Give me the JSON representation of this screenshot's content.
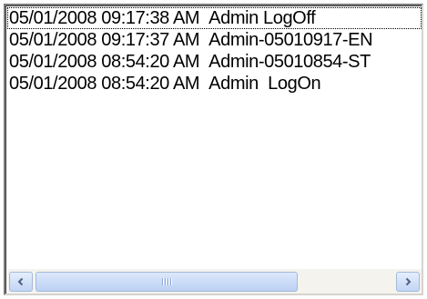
{
  "log_list": {
    "items": [
      {
        "timestamp": "05/01/2008 09:17:38 AM",
        "message": "Admin LogOff"
      },
      {
        "timestamp": "05/01/2008 09:17:37 AM",
        "message": "Admin-05010917-EN"
      },
      {
        "timestamp": "05/01/2008 08:54:20 AM",
        "message": "Admin-05010854-ST"
      },
      {
        "timestamp": "05/01/2008 08:54:20 AM",
        "message": "Admin  LogOn"
      }
    ],
    "focused_index": 0
  },
  "scrollbar": {
    "left_icon": "scroll-left-arrow-icon",
    "right_icon": "scroll-right-arrow-icon",
    "thumb_icon": "grip-icon"
  }
}
